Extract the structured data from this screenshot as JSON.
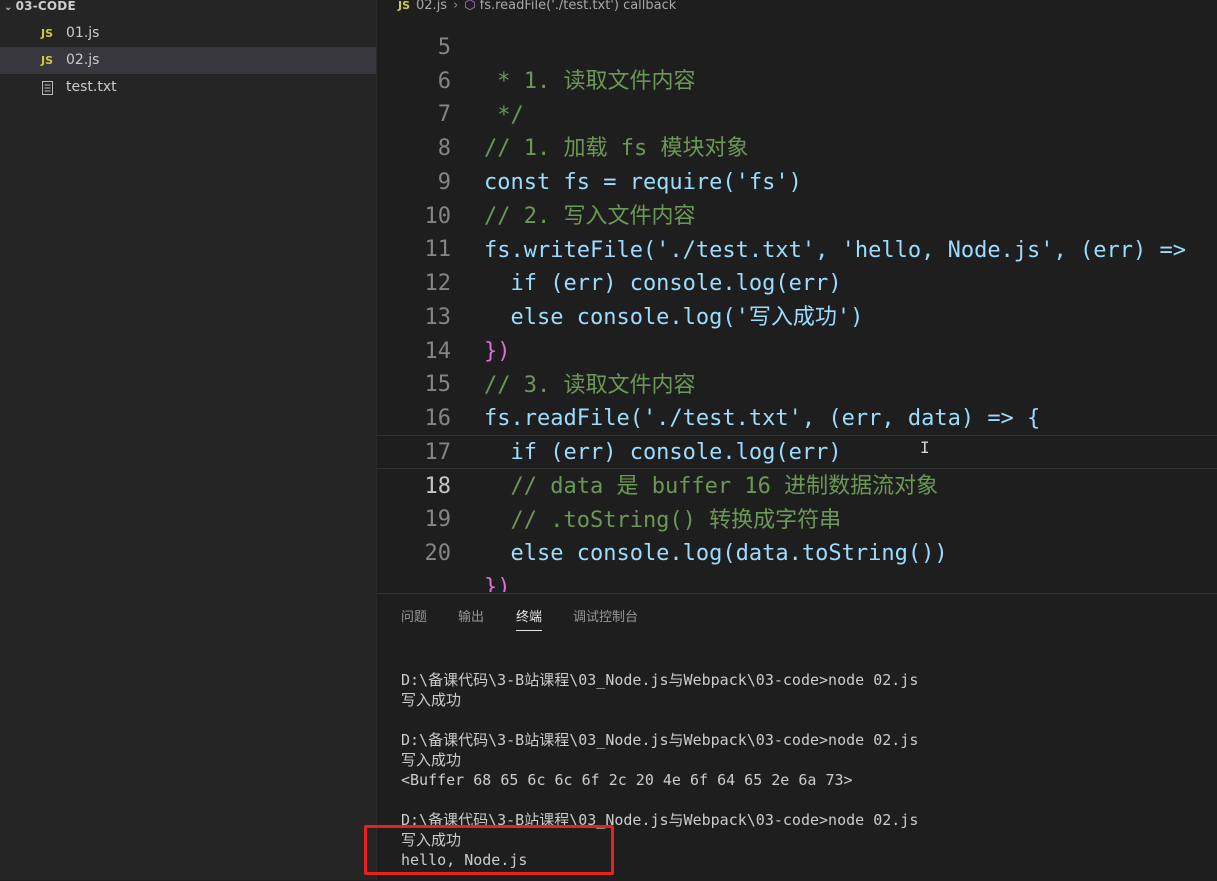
{
  "explorer": {
    "folder": "03-CODE",
    "files": [
      {
        "name": "01.js",
        "type": "js",
        "badge": "JS"
      },
      {
        "name": "02.js",
        "type": "js",
        "badge": "JS",
        "selected": true
      },
      {
        "name": "test.txt",
        "type": "txt"
      }
    ]
  },
  "breadcrumb": {
    "badge": "JS",
    "file": "02.js",
    "symbol": "fs.readFile('./test.txt') callback"
  },
  "editor": {
    "active_line": 18,
    "lines": [
      {
        "num": "5",
        "text": " * 1. 读取文件内容"
      },
      {
        "num": "6",
        "text": " */"
      },
      {
        "num": "7",
        "text": "// 1. 加载 fs 模块对象"
      },
      {
        "num": "8",
        "text": "const fs = require('fs')"
      },
      {
        "num": "9",
        "text": "// 2. 写入文件内容"
      },
      {
        "num": "10",
        "text": "fs.writeFile('./test.txt', 'hello, Node.js', (err) =>"
      },
      {
        "num": "11",
        "text": "  if (err) console.log(err)"
      },
      {
        "num": "12",
        "text": "  else console.log('写入成功')"
      },
      {
        "num": "13",
        "text": "})"
      },
      {
        "num": "14",
        "text": "// 3. 读取文件内容"
      },
      {
        "num": "15",
        "text": "fs.readFile('./test.txt', (err, data) => {"
      },
      {
        "num": "16",
        "text": "  if (err) console.log(err)"
      },
      {
        "num": "17",
        "text": "  // data 是 buffer 16 进制数据流对象"
      },
      {
        "num": "18",
        "text": "  // .toString() 转换成字符串"
      },
      {
        "num": "19",
        "text": "  else console.log(data.toString())"
      },
      {
        "num": "20",
        "text": "})"
      }
    ]
  },
  "panel": {
    "tabs": [
      {
        "label": "问题"
      },
      {
        "label": "输出"
      },
      {
        "label": "终端",
        "active": true
      },
      {
        "label": "调试控制台"
      }
    ],
    "terminal": [
      "D:\\备课代码\\3-B站课程\\03_Node.js与Webpack\\03-code>node 02.js",
      "写入成功",
      "",
      "D:\\备课代码\\3-B站课程\\03_Node.js与Webpack\\03-code>node 02.js",
      "写入成功",
      "<Buffer 68 65 6c 6c 6f 2c 20 4e 6f 64 65 2e 6a 73>",
      "",
      "D:\\备课代码\\3-B站课程\\03_Node.js与Webpack\\03-code>node 02.js",
      "写入成功",
      "hello, Node.js"
    ]
  },
  "colors": {
    "annotation_box": "#e8201e",
    "js_badge": "#cbcb41",
    "comment": "#6a9955",
    "keyword": "#569cd6",
    "string": "#ce9178"
  }
}
